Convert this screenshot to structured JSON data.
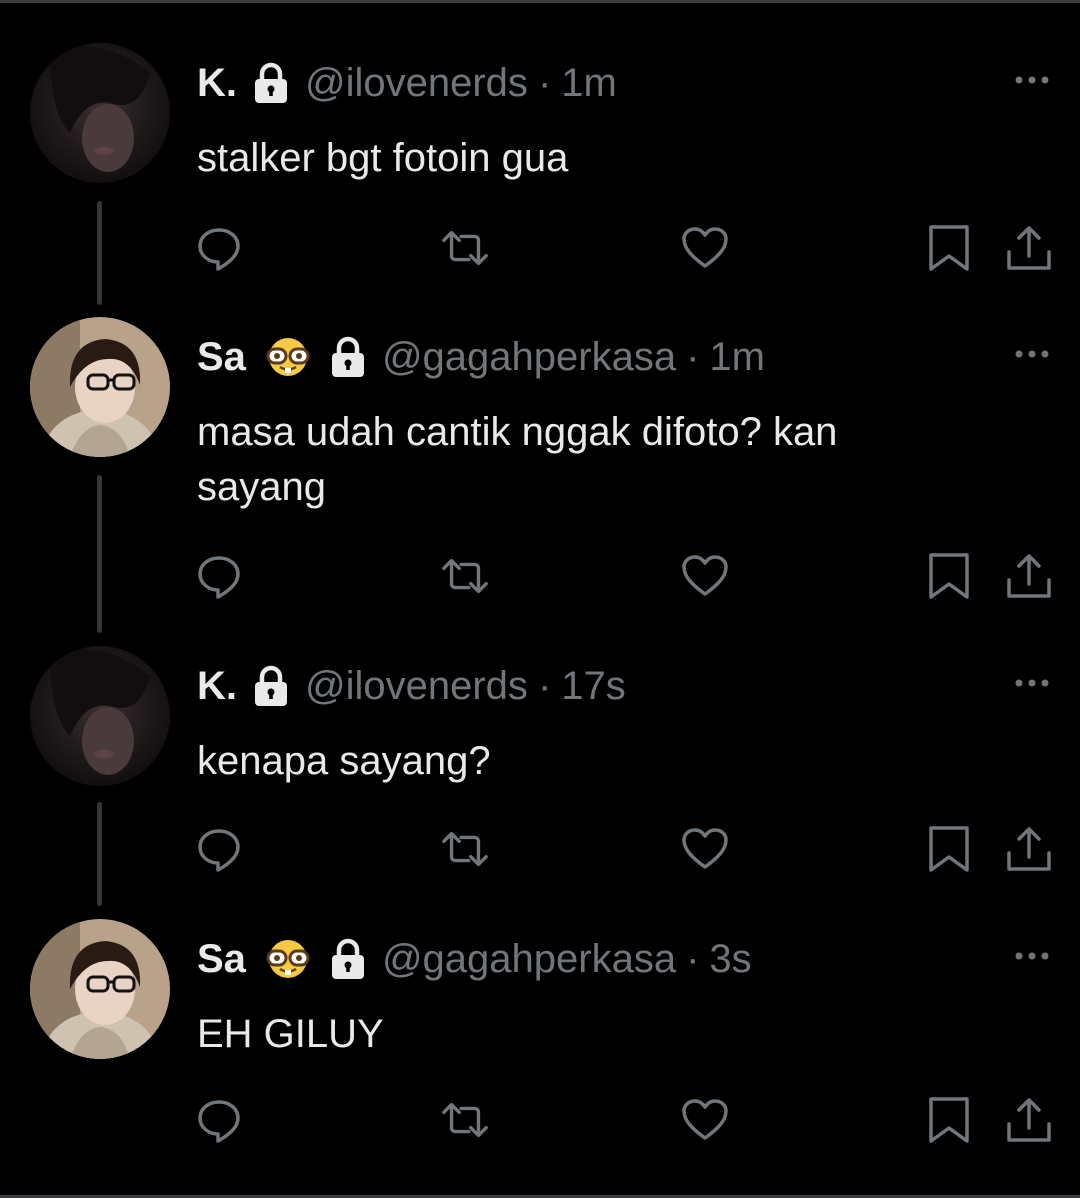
{
  "colors": {
    "background": "#000000",
    "text": "#e7e9ea",
    "muted": "#71767b",
    "thread_line": "#33363a"
  },
  "thread": [
    {
      "name": "K.",
      "has_emoji": false,
      "emoji_icon": "",
      "lock_icon": "lock-icon",
      "handle": "@ilovenerds",
      "separator": "·",
      "time": "1m",
      "text": "stalker bgt fotoin gua",
      "avatar": "avatar-k"
    },
    {
      "name": "Sa",
      "has_emoji": true,
      "emoji_icon": "nerd-face-emoji",
      "lock_icon": "lock-icon",
      "handle": "@gagahperkasa",
      "separator": "·",
      "time": "1m",
      "text": "masa udah cantik nggak difoto? kan\nsayang",
      "avatar": "avatar-sa"
    },
    {
      "name": "K.",
      "has_emoji": false,
      "emoji_icon": "",
      "lock_icon": "lock-icon",
      "handle": "@ilovenerds",
      "separator": "·",
      "time": "17s",
      "text": "kenapa sayang?",
      "avatar": "avatar-k"
    },
    {
      "name": "Sa",
      "has_emoji": true,
      "emoji_icon": "nerd-face-emoji",
      "lock_icon": "lock-icon",
      "handle": "@gagahperkasa",
      "separator": "·",
      "time": "3s",
      "text": "EH GILUY",
      "avatar": "avatar-sa"
    }
  ],
  "action_icons": [
    "reply-icon",
    "retweet-icon",
    "like-icon",
    "bookmark-icon",
    "share-icon"
  ],
  "more_icon": "more-options-icon"
}
